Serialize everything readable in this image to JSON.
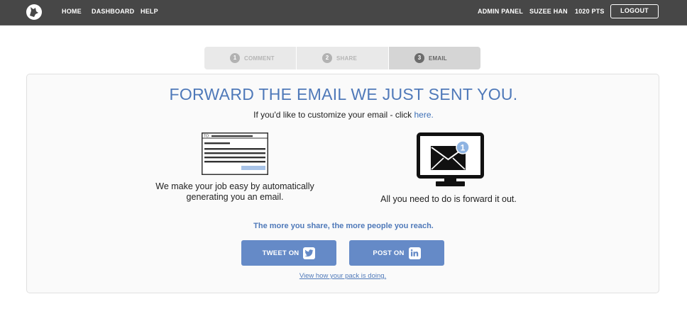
{
  "nav": {
    "links": [
      "HOME",
      "DASHBOARD",
      "HELP"
    ],
    "admin_panel": "ADMIN PANEL",
    "user_name": "SUZEE HAN",
    "points": "1020 PTS",
    "logout_label": "LOGOUT"
  },
  "steps": [
    {
      "num": "1",
      "label": "COMMENT",
      "active": false
    },
    {
      "num": "2",
      "label": "SHARE",
      "active": false
    },
    {
      "num": "3",
      "label": "EMAIL",
      "active": true
    }
  ],
  "main": {
    "headline": "FORWARD THE EMAIL WE JUST SENT YOU.",
    "sub_text": "If you'd like to customize your email - click ",
    "sub_link": "here.",
    "doc_to_label": "TO:",
    "monitor_badge": "1",
    "left_caption": "We make your job easy by automatically generating you an email.",
    "right_caption": "All you need to do is forward it out.",
    "tagline": "The more you share, the more people you reach.",
    "tweet_label": "TWEET ON",
    "post_label": "POST ON",
    "pack_link": "View how your pack is doing."
  },
  "colors": {
    "nav_bg": "#474747",
    "accent": "#4f79b9",
    "button_bg": "#658ac7",
    "badge": "#8fb4e2"
  }
}
